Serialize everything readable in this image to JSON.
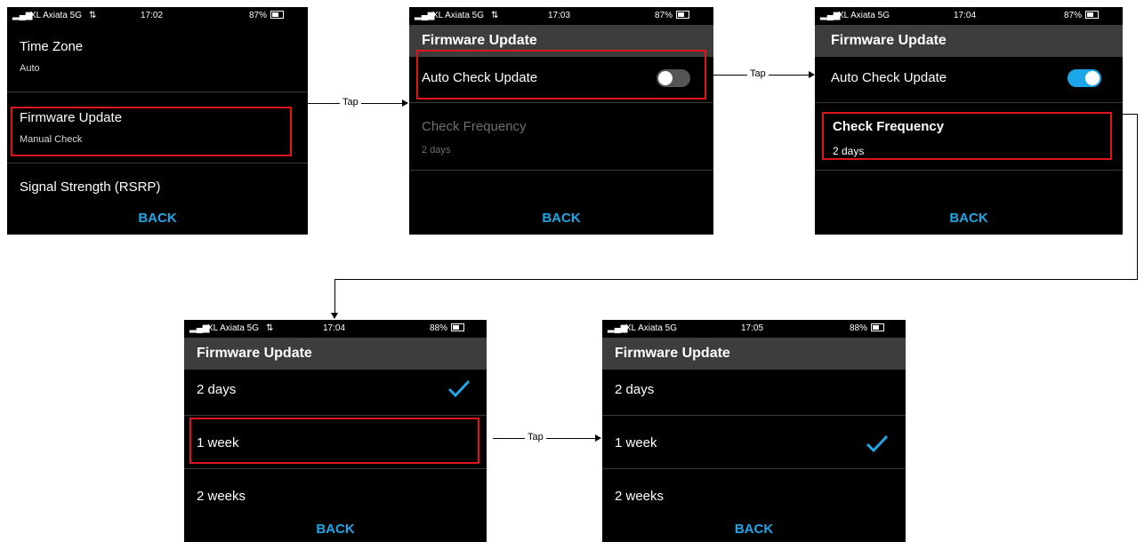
{
  "screens": [
    {
      "status": {
        "carrier": "XL Axiata 5G",
        "net": "⇅",
        "time": "17:02",
        "battery": "87%"
      },
      "rows": [
        {
          "title": "Time Zone",
          "sub": "Auto"
        },
        {
          "title": "Firmware Update",
          "sub": "Manual Check"
        },
        {
          "title": "Signal Strength (RSRP)"
        }
      ],
      "back": "BACK"
    },
    {
      "status": {
        "carrier": "XL Axiata 5G",
        "net": "⇅",
        "time": "17:03",
        "battery": "87%"
      },
      "header": "Firmware Update",
      "rows": [
        {
          "title": "Auto Check Update",
          "toggle": "off"
        },
        {
          "title": "Check Frequency",
          "sub": "2 days"
        }
      ],
      "back": "BACK"
    },
    {
      "status": {
        "carrier": "XL Axiata 5G",
        "time": "17:04",
        "battery": "87%"
      },
      "header": "Firmware Update",
      "rows": [
        {
          "title": "Auto Check Update",
          "toggle": "on"
        },
        {
          "title": "Check Frequency",
          "sub": "2 days"
        }
      ],
      "back": "BACK"
    },
    {
      "status": {
        "carrier": "XL Axiata 5G",
        "net": "⇅",
        "time": "17:04",
        "battery": "88%"
      },
      "header": "Firmware Update",
      "options": [
        "2 days",
        "1 week",
        "2 weeks"
      ],
      "selected": "2 days",
      "back": "BACK"
    },
    {
      "status": {
        "carrier": "XL Axiata 5G",
        "time": "17:05",
        "battery": "88%"
      },
      "header": "Firmware Update",
      "options": [
        "2 days",
        "1 week",
        "2 weeks"
      ],
      "selected": "1 week",
      "back": "BACK"
    }
  ],
  "tap_label": "Tap",
  "colors": {
    "highlight": "#e0141a",
    "accent": "#1ea7e8",
    "toggle_on": "#1ea7e8",
    "toggle_off": "#555555"
  }
}
